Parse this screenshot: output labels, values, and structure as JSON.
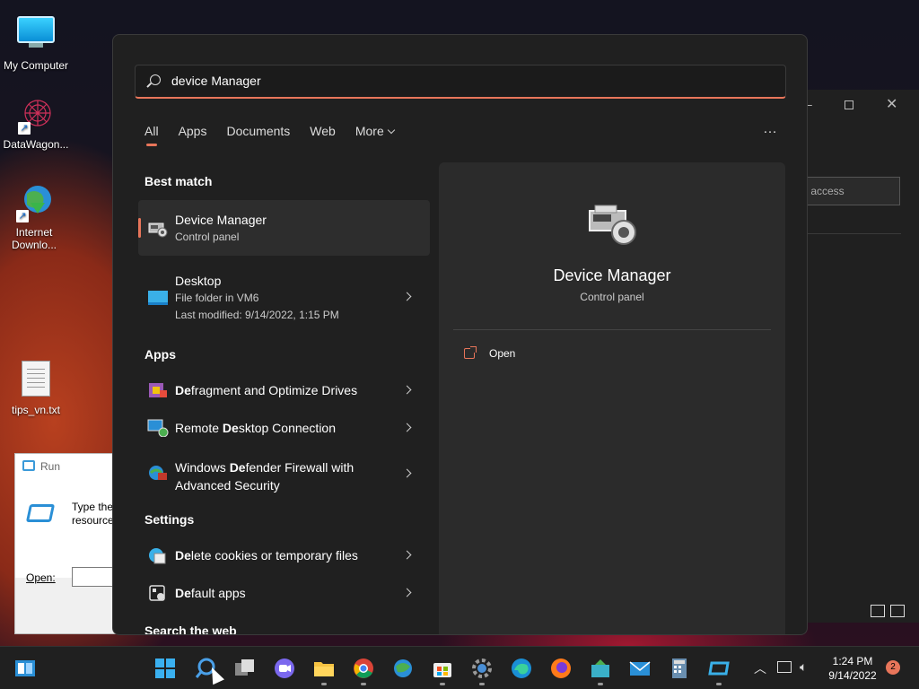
{
  "desktop": {
    "icons": [
      {
        "label": "My Computer",
        "icon": "monitor-icon"
      },
      {
        "label": "DataWagon...",
        "icon": "datawagon-icon"
      },
      {
        "label": "Internet Downlo...",
        "icon": "download-manager-icon"
      },
      {
        "label": "tips_vn.txt",
        "icon": "text-file-icon"
      }
    ]
  },
  "run_dialog": {
    "title": "Run",
    "description": "Type the resource",
    "open_label": "Open:",
    "open_value": ""
  },
  "background_window": {
    "search_placeholder": "ck access"
  },
  "search": {
    "query": "device Manager",
    "filters": [
      "All",
      "Apps",
      "Documents",
      "Web",
      "More"
    ],
    "active_filter": "All",
    "more_options": "…"
  },
  "results": {
    "best_match_title": "Best match",
    "best_match": [
      {
        "title": "Device Manager",
        "subtitle": "Control panel",
        "icon": "device-manager-icon"
      },
      {
        "title": "Desktop",
        "subtitle": "File folder in VM6",
        "subtitle2": "Last modified: 9/14/2022, 1:15 PM",
        "icon": "desktop-folder-icon"
      }
    ],
    "apps_title": "Apps",
    "apps": [
      {
        "prefix": "",
        "bold": "De",
        "suffix": "fragment and Optimize Drives",
        "icon": "defrag-icon"
      },
      {
        "prefix": "Remote ",
        "bold": "De",
        "suffix": "sktop Connection",
        "icon": "remote-desktop-icon"
      },
      {
        "prefix": "Windows ",
        "bold": "De",
        "suffix": "fender Firewall with",
        "line2": "Advanced Security",
        "icon": "firewall-icon"
      }
    ],
    "settings_title": "Settings",
    "settings": [
      {
        "prefix": "",
        "bold": "De",
        "suffix": "lete cookies or temporary files",
        "icon": "internet-options-icon"
      },
      {
        "prefix": "",
        "bold": "De",
        "suffix": "fault apps",
        "icon": "default-apps-icon"
      }
    ],
    "web_title": "Search the web"
  },
  "detail": {
    "title": "Device Manager",
    "subtitle": "Control panel",
    "open_label": "Open"
  },
  "taskbar": {
    "time": "1:24 PM",
    "date": "9/14/2022",
    "notifications": "2",
    "apps": [
      "start-icon",
      "search-icon",
      "task-view-icon",
      "chat-icon",
      "file-explorer-icon",
      "chrome-icon",
      "network-app-icon",
      "store-icon",
      "settings-icon",
      "edge-icon",
      "firefox-icon",
      "vm-tool-icon",
      "mail-icon",
      "calculator-icon",
      "run-icon"
    ]
  },
  "colors": {
    "accent": "#e8755a",
    "panel": "#202020",
    "detail_pane": "#2b2b2b"
  }
}
